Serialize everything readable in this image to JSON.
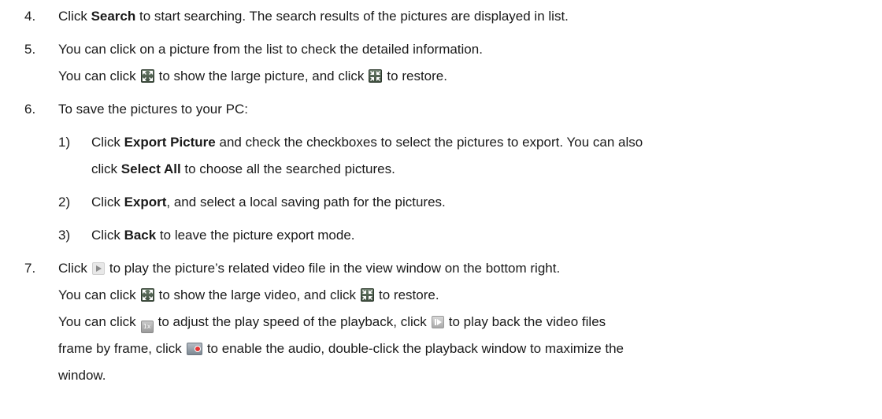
{
  "steps": [
    {
      "num": "4.",
      "parts": [
        {
          "t": "Click "
        },
        {
          "b": "Search"
        },
        {
          "t": " to start searching. The search results of the pictures are displayed in list."
        }
      ]
    },
    {
      "num": "5.",
      "parts": [
        {
          "t": "You can click on a picture from the list to check the detailed information."
        }
      ]
    },
    {
      "num": "",
      "parts": [
        {
          "t": "You can click"
        },
        {
          "icon": "fullscreen-icon"
        },
        {
          "t": "to show the large picture, and click"
        },
        {
          "icon": "restore-icon"
        },
        {
          "t": "to restore."
        }
      ]
    },
    {
      "num": "6.",
      "parts": [
        {
          "t": "To save the pictures to your PC:"
        }
      ]
    },
    {
      "num": "1)",
      "parts": [
        {
          "t": "Click "
        },
        {
          "b": "Export Picture"
        },
        {
          "t": " and check the checkboxes to select the pictures to export. You can also"
        }
      ]
    },
    {
      "num": "",
      "parts": [
        {
          "t": "click "
        },
        {
          "b": "Select All"
        },
        {
          "t": " to choose all the searched pictures."
        }
      ]
    },
    {
      "num": "2)",
      "parts": [
        {
          "t": "Click "
        },
        {
          "b": "Export"
        },
        {
          "t": ", and select a local saving path for the pictures."
        }
      ]
    },
    {
      "num": "3)",
      "parts": [
        {
          "t": "Click "
        },
        {
          "b": "Back"
        },
        {
          "t": " to leave the picture export mode."
        }
      ]
    },
    {
      "num": "7.",
      "parts": [
        {
          "t": "Click"
        },
        {
          "icon": "play-icon"
        },
        {
          "t": "to play the picture’s related video file in the view window on the bottom right."
        }
      ]
    },
    {
      "num": "",
      "parts": [
        {
          "t": "You can click"
        },
        {
          "icon": "fullscreen-icon"
        },
        {
          "t": "to show the large video, and click"
        },
        {
          "icon": "restore-icon"
        },
        {
          "t": "to restore."
        }
      ]
    },
    {
      "num": "",
      "parts": [
        {
          "t": "You can click"
        },
        {
          "icon": "speed-icon",
          "label": "1x"
        },
        {
          "t": "to adjust the play speed of the playback, click"
        },
        {
          "icon": "frame-icon"
        },
        {
          "t": "to play back the video files"
        }
      ]
    },
    {
      "num": "",
      "parts": [
        {
          "t": "frame by frame, click"
        },
        {
          "icon": "audio-icon"
        },
        {
          "t": "to enable the audio, double-click the playback window to maximize the"
        }
      ]
    },
    {
      "num": "",
      "parts": [
        {
          "t": "window."
        }
      ]
    }
  ]
}
